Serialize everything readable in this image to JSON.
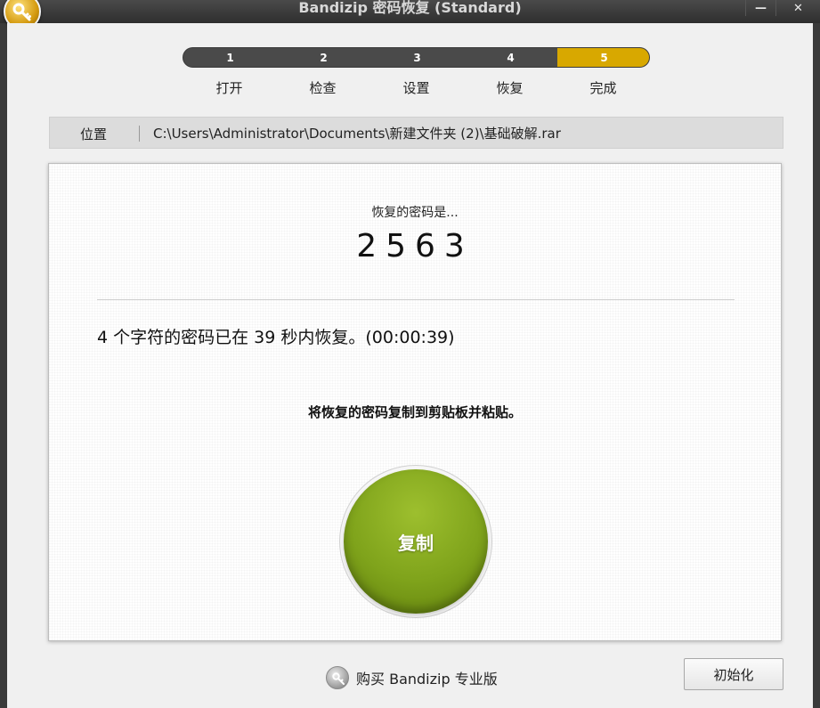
{
  "window": {
    "title": "Bandizip 密码恢复 (Standard)",
    "minimize_label": "—",
    "close_label": "✕"
  },
  "stepper": {
    "active_step": 5,
    "accent_color": "#d8a800",
    "steps": [
      {
        "number": "1",
        "label": "打开"
      },
      {
        "number": "2",
        "label": "检查"
      },
      {
        "number": "3",
        "label": "设置"
      },
      {
        "number": "4",
        "label": "恢复"
      },
      {
        "number": "5",
        "label": "完成"
      }
    ]
  },
  "location": {
    "label": "位置",
    "path": "C:\\Users\\Administrator\\Documents\\新建文件夹 (2)\\基础破解.rar"
  },
  "result": {
    "caption": "恢复的密码是...",
    "password": "2563",
    "summary": "4 个字符的密码已在 39 秒内恢复。(00:00:39)",
    "copy_hint": "将恢复的密码复制到剪贴板并粘贴。",
    "copy_button": "复制"
  },
  "footer": {
    "buy_label": "购买 Bandizip 专业版",
    "reset_button": "初始化"
  },
  "icons": {
    "app": "key-icon",
    "buy": "key-icon"
  }
}
